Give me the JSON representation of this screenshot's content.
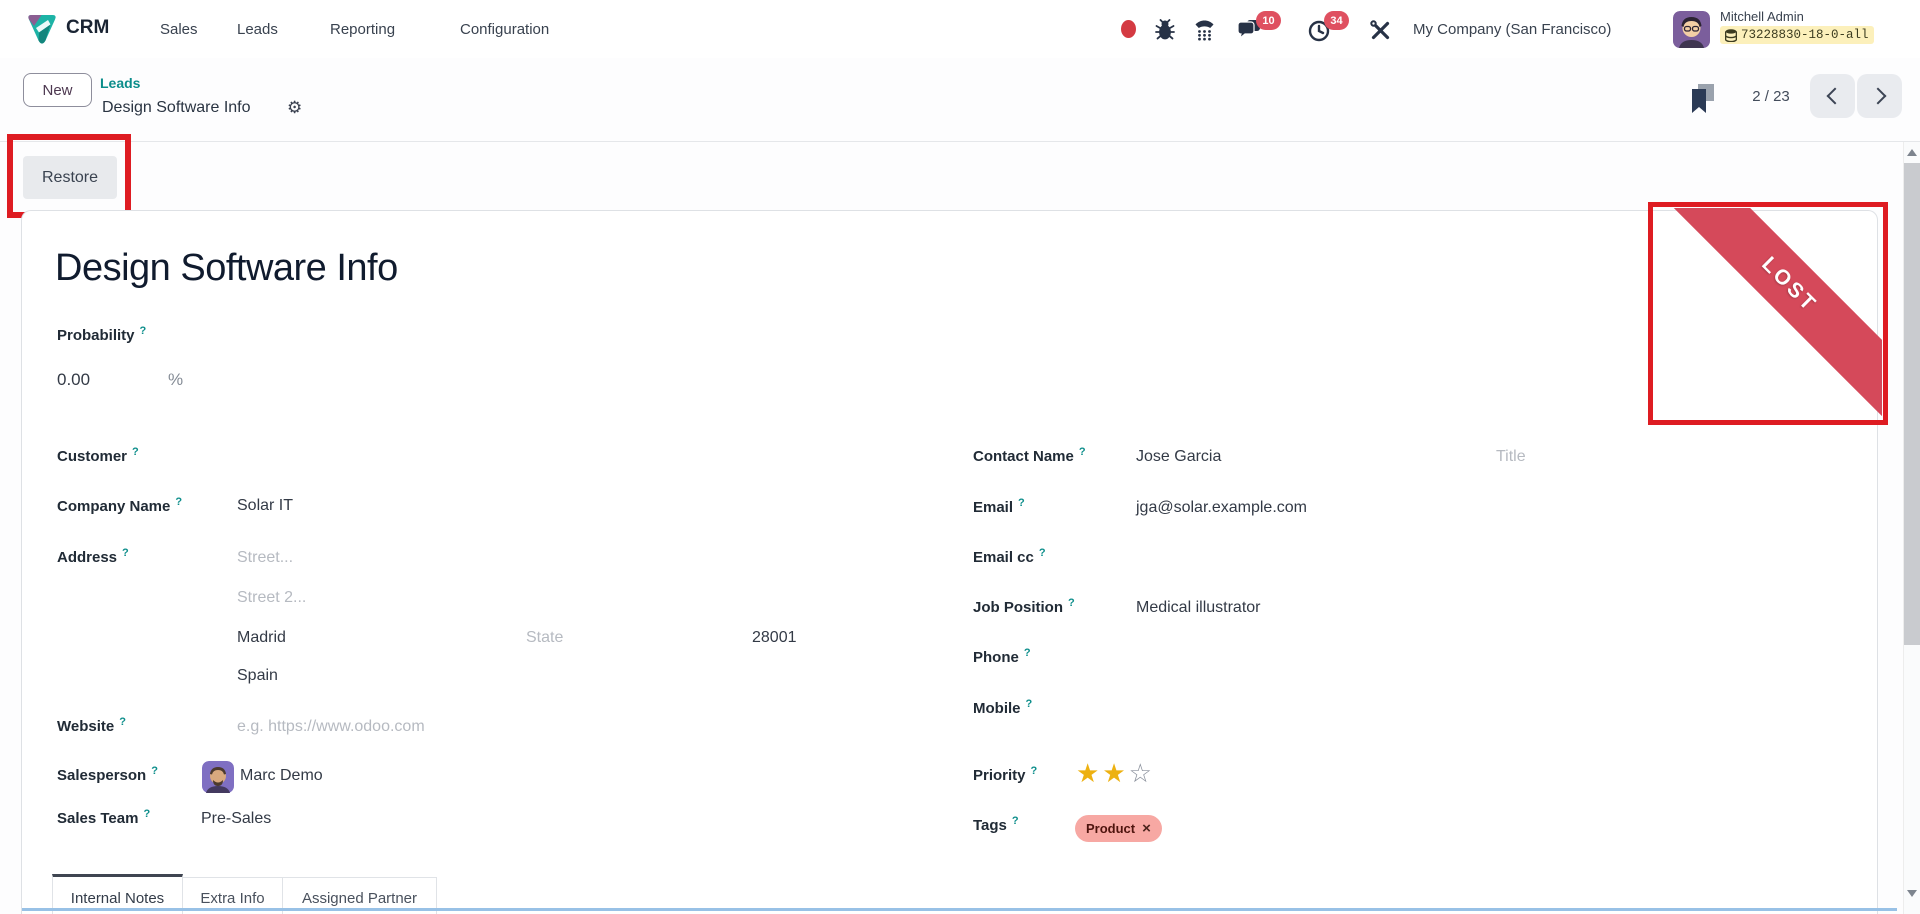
{
  "nav": {
    "app_name": "CRM",
    "menu": [
      "Sales",
      "Leads",
      "Reporting",
      "Configuration"
    ],
    "company": "My Company (San Francisco)",
    "user_name": "Mitchell Admin",
    "db_badge": "73228830-18-0-all",
    "message_count": "10",
    "activity_count": "34"
  },
  "control_panel": {
    "new_button": "New",
    "breadcrumb_parent": "Leads",
    "breadcrumb_current": "Design Software Info",
    "pager": "2 / 23"
  },
  "statusbar": {
    "restore_button": "Restore"
  },
  "ribbon": {
    "label": "LOST"
  },
  "form": {
    "title": "Design Software Info",
    "probability": {
      "label": "Probability",
      "value": "0.00",
      "unit": "%"
    },
    "customer": {
      "label": "Customer"
    },
    "company_name": {
      "label": "Company Name",
      "value": "Solar IT"
    },
    "address": {
      "label": "Address",
      "street_placeholder": "Street...",
      "street2_placeholder": "Street 2...",
      "city": "Madrid",
      "state_placeholder": "State",
      "zip": "28001",
      "country": "Spain"
    },
    "website": {
      "label": "Website",
      "placeholder": "e.g. https://www.odoo.com"
    },
    "salesperson": {
      "label": "Salesperson",
      "value": "Marc Demo"
    },
    "sales_team": {
      "label": "Sales Team",
      "value": "Pre-Sales"
    },
    "contact_name": {
      "label": "Contact Name",
      "value": "Jose Garcia",
      "title_placeholder": "Title"
    },
    "email": {
      "label": "Email",
      "value": "jga@solar.example.com"
    },
    "email_cc": {
      "label": "Email cc"
    },
    "job_position": {
      "label": "Job Position",
      "value": "Medical illustrator"
    },
    "phone": {
      "label": "Phone"
    },
    "mobile": {
      "label": "Mobile"
    },
    "priority": {
      "label": "Priority",
      "stars_filled": 2,
      "stars_total": 3
    },
    "tags": {
      "label": "Tags",
      "tag": "Product"
    }
  },
  "tabs": [
    "Internal Notes",
    "Extra Info",
    "Assigned Partner"
  ],
  "ui": {
    "help": "?",
    "gear": "⚙",
    "star_filled": "★",
    "star_empty": "☆",
    "remove": "×"
  },
  "colors": {
    "teal": "#0b8d8b",
    "ribbon_red": "#d5495a",
    "annotation_red": "#de1c22",
    "badge_red": "#df5060",
    "tag_bg": "#f7a8a3",
    "star_gold": "#edb111"
  }
}
